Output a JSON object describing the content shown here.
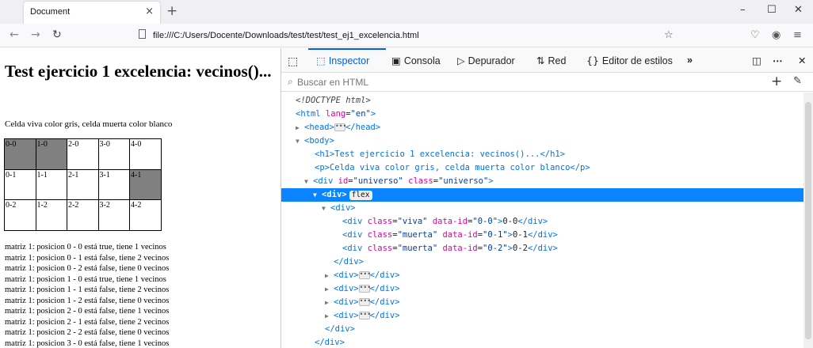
{
  "browser": {
    "tab_title": "Document",
    "tab_close": "×",
    "new_tab": "+",
    "url": "file:///C:/Users/Docente/Downloads/test/test/test_ej1_excelencia.html",
    "window_controls": {
      "minimize": "–",
      "maximize": "☐",
      "close": "✕"
    }
  },
  "page": {
    "title": "Test ejercicio 1 excelencia: vecinos()...",
    "subtitle": "Celda viva color gris, celda muerta color blanco",
    "grid": [
      [
        {
          "label": "0-0",
          "alive": true
        },
        {
          "label": "1-0",
          "alive": true
        },
        {
          "label": "2-0",
          "alive": false
        },
        {
          "label": "3-0",
          "alive": false
        },
        {
          "label": "4-0",
          "alive": false
        }
      ],
      [
        {
          "label": "0-1",
          "alive": false
        },
        {
          "label": "1-1",
          "alive": false
        },
        {
          "label": "2-1",
          "alive": false
        },
        {
          "label": "3-1",
          "alive": false
        },
        {
          "label": "4-1",
          "alive": true
        }
      ],
      [
        {
          "label": "0-2",
          "alive": false
        },
        {
          "label": "1-2",
          "alive": false
        },
        {
          "label": "2-2",
          "alive": false
        },
        {
          "label": "3-2",
          "alive": false
        },
        {
          "label": "4-2",
          "alive": false
        }
      ]
    ],
    "log": [
      "matriz 1: posicion 0 - 0 está true, tiene 1 vecinos",
      "matriz 1: posicion 0 - 1 está false, tiene 2 vecinos",
      "matriz 1: posicion 0 - 2 está false, tiene 0 vecinos",
      "matriz 1: posicion 1 - 0 está true, tiene 1 vecinos",
      "matriz 1: posicion 1 - 1 está false, tiene 2 vecinos",
      "matriz 1: posicion 1 - 2 está false, tiene 0 vecinos",
      "matriz 1: posicion 2 - 0 está false, tiene 1 vecinos",
      "matriz 1: posicion 2 - 1 está false, tiene 2 vecinos",
      "matriz 1: posicion 2 - 2 está false, tiene 0 vecinos",
      "matriz 1: posicion 3 - 0 está false, tiene 1 vecinos"
    ]
  },
  "devtools": {
    "tabs": {
      "inspector": "Inspector",
      "console": "Consola",
      "debugger": "Depurador",
      "network": "Red",
      "style_editor": "Editor de estilos"
    },
    "search_placeholder": "Buscar en HTML",
    "flex_badge": "flex",
    "tree": {
      "doctype": "<!DOCTYPE html>",
      "html_open": "<html",
      "html_lang_attr": " lang",
      "html_lang_val": "\"en\"",
      "head": "<head>",
      "head_close": "</head>",
      "body": "<body>",
      "h1_line": "<h1>Test ejercicio 1 excelencia: vecinos()...</h1>",
      "p_line": "<p>Celda viva color gris, celda muerta color blanco</p>",
      "div_open": "<div",
      "id_attr": " id",
      "id_val": "\"universo\"",
      "class_attr": " class",
      "class_val": "\"universo\"",
      "div_tag": "<div>",
      "div_close": "</div>",
      "viva_val": "\"viva\"",
      "muerta_val": "\"muerta\"",
      "dataid_attr": " data-id",
      "cell_00_val": "\"0-0\"",
      "cell_00_text": "0-0",
      "cell_01_val": "\"0-1\"",
      "cell_01_text": "0-1",
      "cell_02_val": "\"0-2\"",
      "cell_02_text": "0-2",
      "gt": ">",
      "eq": "="
    }
  }
}
